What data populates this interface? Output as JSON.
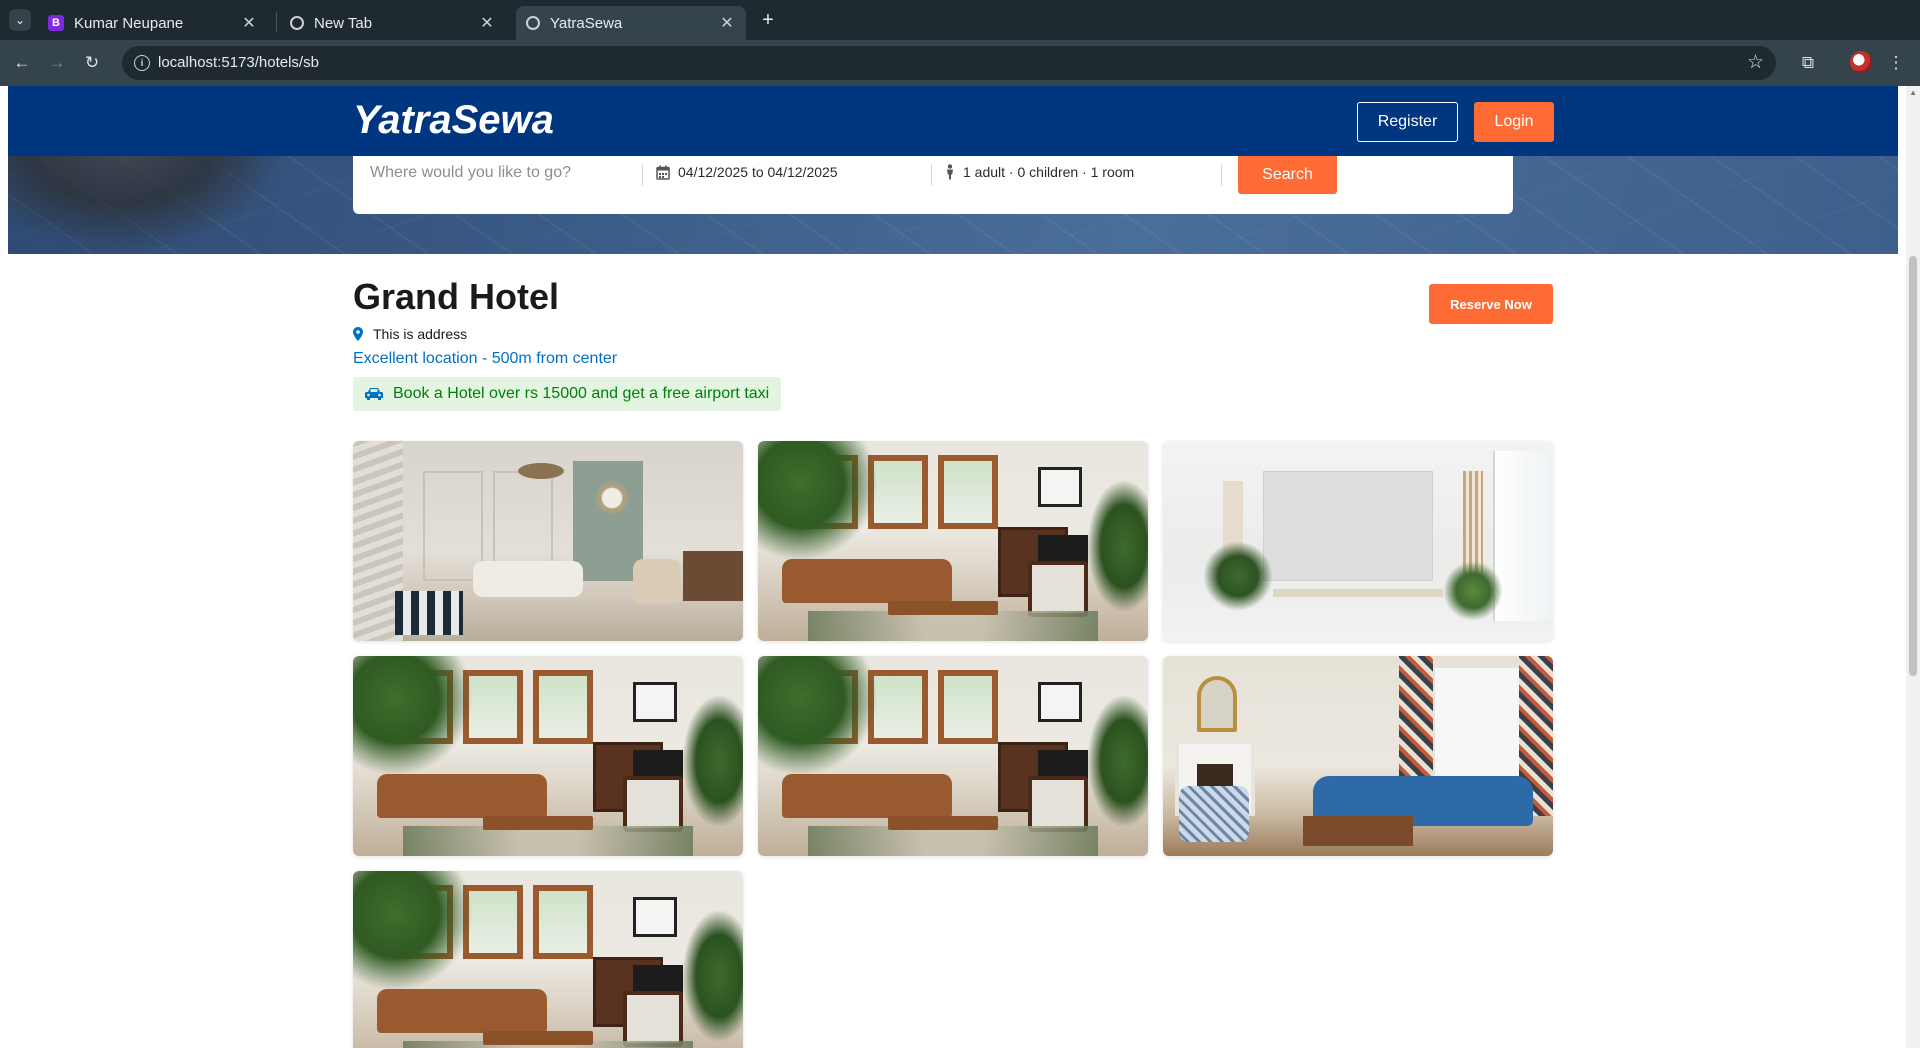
{
  "browser": {
    "tabs": [
      {
        "title": "Kumar Neupane",
        "favicon": "B"
      },
      {
        "title": "New Tab",
        "favicon": "globe"
      },
      {
        "title": "YatraSewa",
        "favicon": "globe",
        "active": true
      }
    ],
    "url": "localhost:5173/hotels/sb"
  },
  "nav": {
    "logo": "YatraSewa",
    "register_label": "Register",
    "login_label": "Login"
  },
  "search": {
    "destination_placeholder": "Where would you like to go?",
    "dates": "04/12/2025 to 04/12/2025",
    "guests": "1 adult · 0 children · 1 room",
    "button_label": "Search"
  },
  "hotel": {
    "name": "Grand Hotel",
    "address": "This is address",
    "location_note": "Excellent location - 500m from center",
    "promo": "Book a Hotel over rs 15000 and get a free airport taxi",
    "reserve_label": "Reserve Now",
    "photos": [
      "grey-paneled-living-room",
      "wood-window-living-room",
      "empty-bright-room",
      "wood-window-living-room",
      "wood-window-living-room",
      "blue-sofa-living-room",
      "wood-window-living-room"
    ]
  },
  "colors": {
    "brand_navy": "#003580",
    "accent_orange": "#ff6b35",
    "link_blue": "#0071c2",
    "promo_green": "#008009"
  }
}
